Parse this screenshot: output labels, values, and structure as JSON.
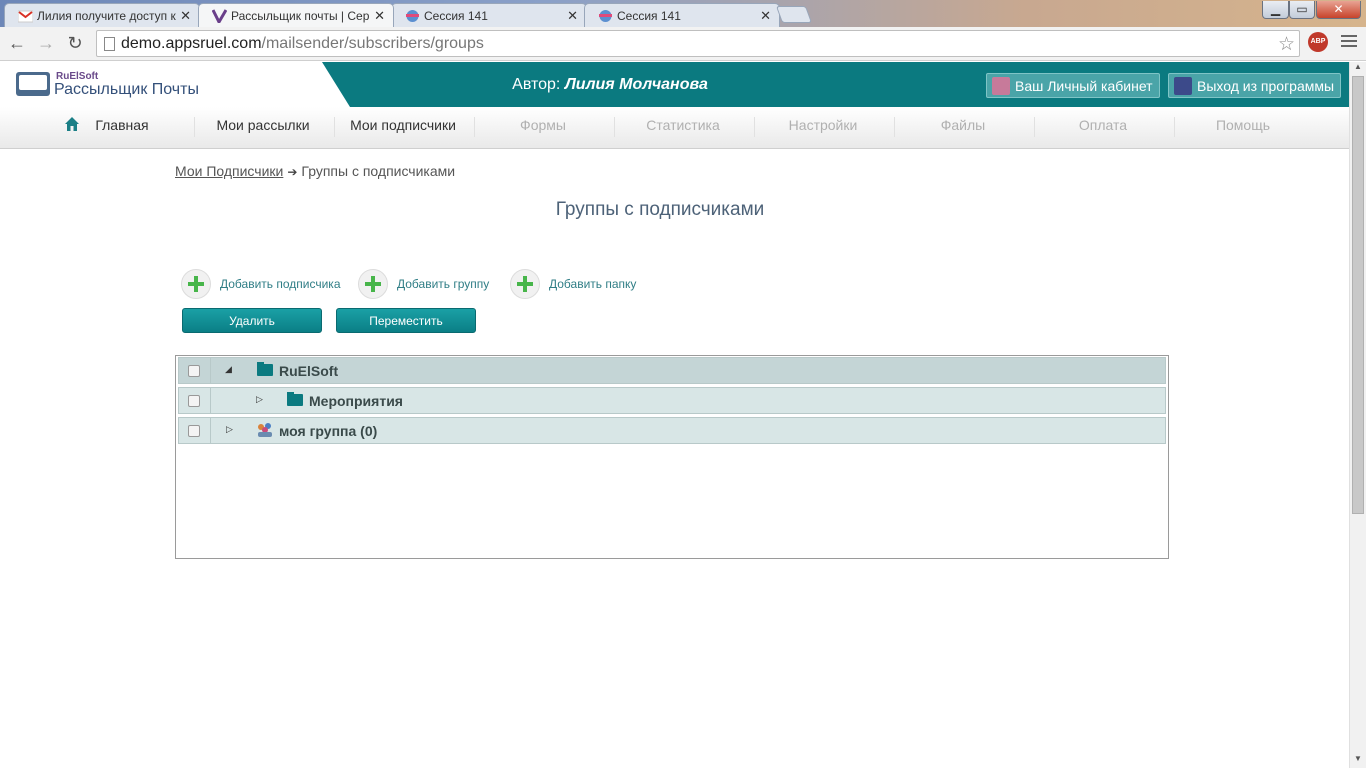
{
  "browser": {
    "tabs": [
      {
        "title": "Лилия получите доступ к"
      },
      {
        "title": "Рассыльщик почты | Сер"
      },
      {
        "title": "Сессия 141"
      },
      {
        "title": "Сессия 141"
      }
    ],
    "url_host": "demo.appsruel.com",
    "url_path": "/mailsender/subscribers/groups",
    "extension_label": "ABP"
  },
  "header": {
    "logo_small": "RuElSoft",
    "logo_big": "Рассыльщик Почты",
    "author_label": "Автор:",
    "author_name": "Лилия Молчанова",
    "cabinet_label": "Ваш Личный кабинет",
    "exit_label": "Выход из программы"
  },
  "nav": {
    "items": [
      {
        "label": "Главная"
      },
      {
        "label": "Мои рассылки"
      },
      {
        "label": "Мои подписчики"
      },
      {
        "label": "Формы"
      },
      {
        "label": "Статистика"
      },
      {
        "label": "Настройки"
      },
      {
        "label": "Файлы"
      },
      {
        "label": "Оплата"
      },
      {
        "label": "Помощь"
      }
    ]
  },
  "breadcrumb": {
    "link": "Мои Подписчики",
    "current": "Группы с подписчиками"
  },
  "page_title": "Группы с подписчиками",
  "actions": {
    "add_subscriber": "Добавить подписчика",
    "add_group": "Добавить группу",
    "add_folder": "Добавить папку",
    "delete": "Удалить",
    "move": "Переместить"
  },
  "tree": {
    "rows": [
      {
        "name": "RuElSoft",
        "kind": "folder"
      },
      {
        "name": "Мероприятия",
        "kind": "folder"
      },
      {
        "name": "моя группа (0)",
        "kind": "group"
      }
    ]
  },
  "colors": {
    "brand": "#0b7a80",
    "tree_row": "#d8e6e6",
    "plus_green": "#47b54a"
  }
}
